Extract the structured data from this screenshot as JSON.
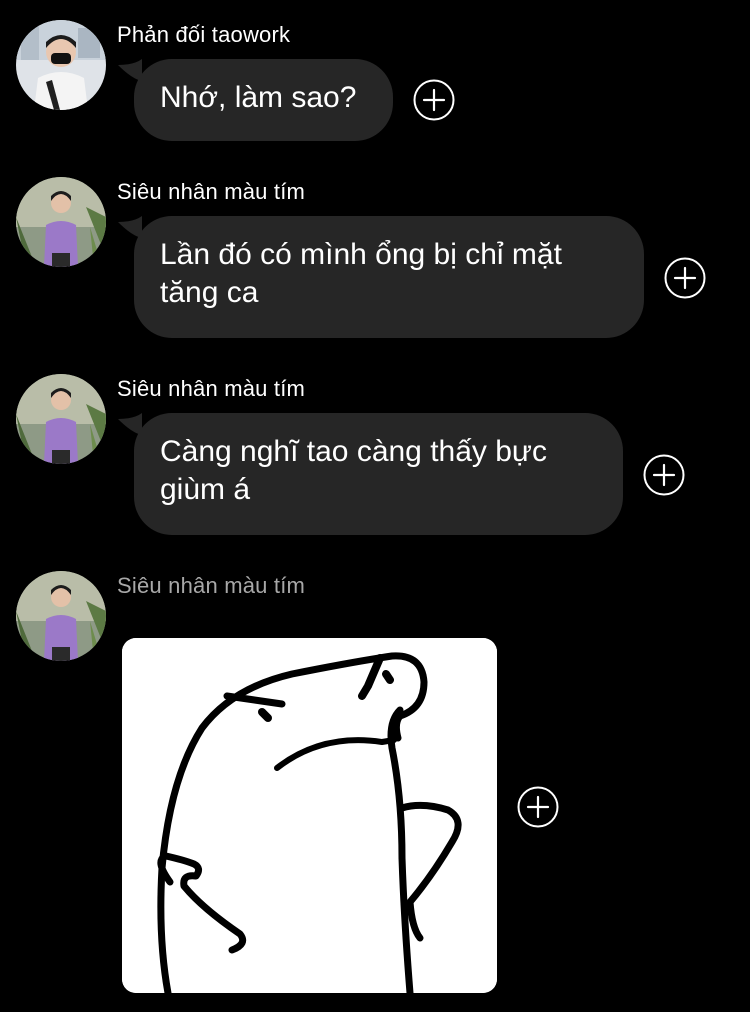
{
  "messages": [
    {
      "sender": "Phản đối taowork",
      "text": "Nhớ, làm sao?"
    },
    {
      "sender": "Siêu nhân màu tím",
      "text": "Lần đó có mình ổng bị chỉ mặt tăng ca"
    },
    {
      "sender": "Siêu nhân màu tím",
      "text": "Càng nghĩ tao càng thấy bực giùm á"
    },
    {
      "sender": "Siêu nhân màu tím",
      "sticker": "frog-meme-sticker"
    }
  ],
  "icons": {
    "react": "add-reaction-icon"
  },
  "colors": {
    "background": "#000000",
    "bubble": "#262626",
    "text": "#ffffff",
    "sender_active": "#ffffff",
    "sender_dim": "#a8a8a8"
  }
}
